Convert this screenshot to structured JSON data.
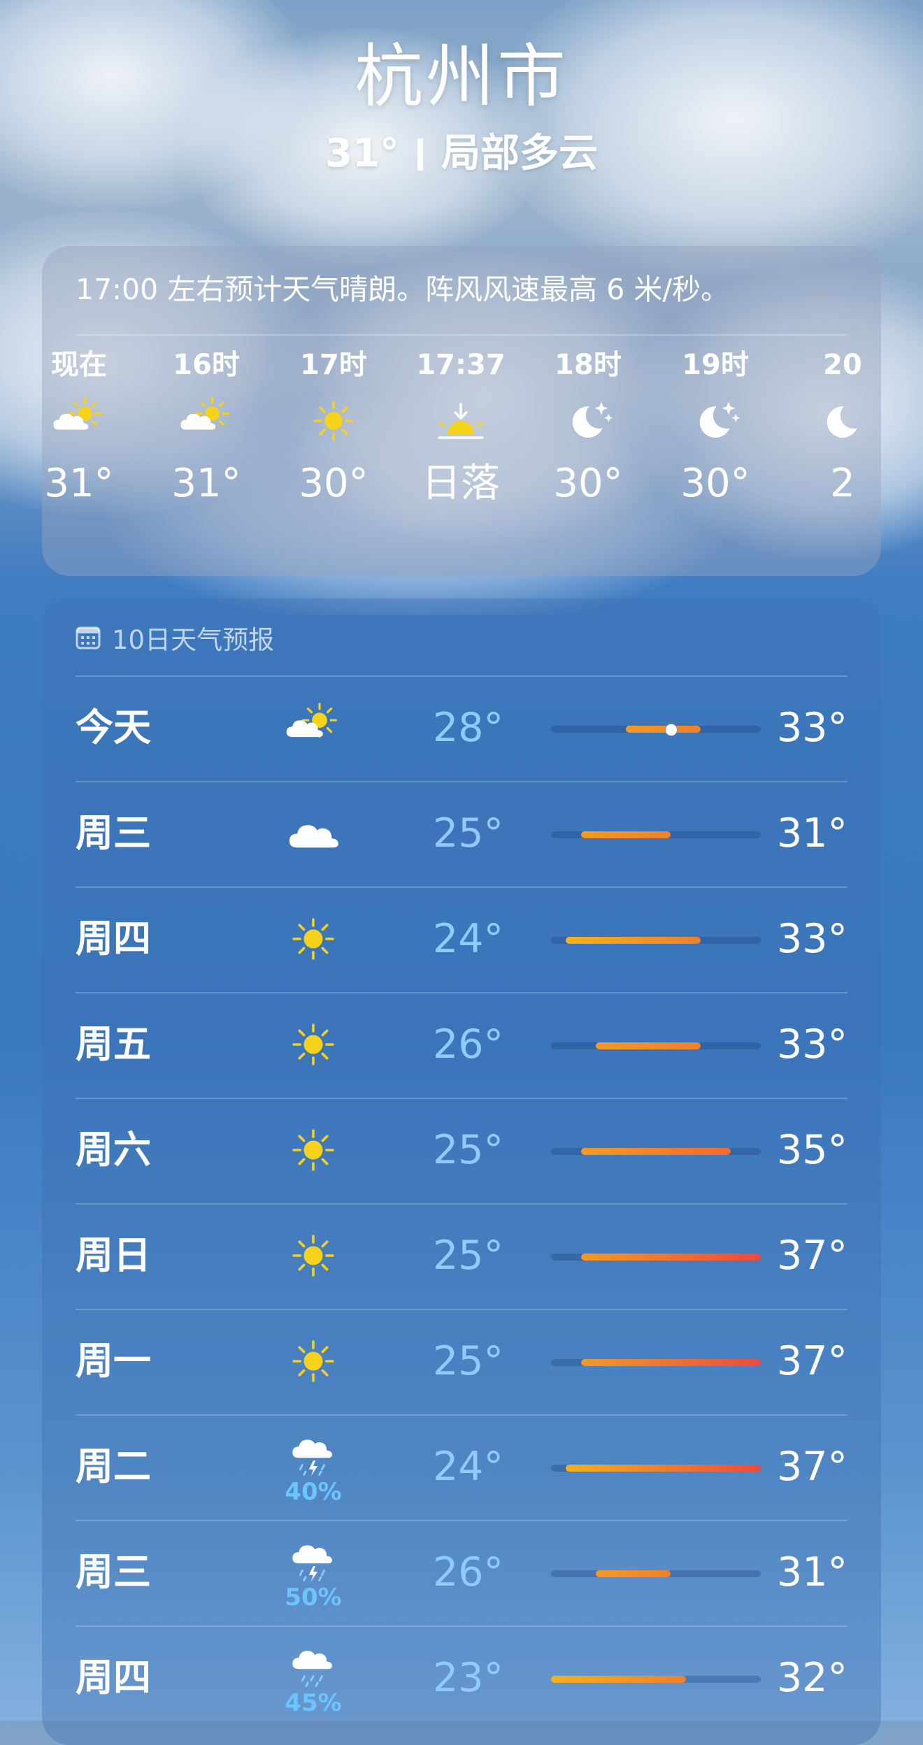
{
  "location": {
    "city": "杭州市",
    "current_temp": "31°",
    "condition": "局部多云"
  },
  "hourly": {
    "description": "17:00 左右预计天气晴朗。阵风风速最高 6 米/秒。",
    "items": [
      {
        "time": "现在",
        "icon": "partly-sunny-icon",
        "value": "31°"
      },
      {
        "time": "16时",
        "icon": "partly-sunny-icon",
        "value": "31°"
      },
      {
        "time": "17时",
        "icon": "sun-icon",
        "value": "30°"
      },
      {
        "time": "17:37",
        "icon": "sunset-icon",
        "value": "日落"
      },
      {
        "time": "18时",
        "icon": "moon-stars-icon",
        "value": "30°"
      },
      {
        "time": "19时",
        "icon": "moon-stars-icon",
        "value": "30°"
      },
      {
        "time": "20",
        "icon": "moon-icon",
        "value": "2"
      }
    ]
  },
  "daily": {
    "header": "10日天气预报",
    "range": {
      "min": 23,
      "max": 37
    },
    "days": [
      {
        "day": "今天",
        "icon": "partly-sunny-icon",
        "precip": "",
        "low": "28°",
        "high": "33°",
        "low_val": 28,
        "high_val": 33,
        "current": 31
      },
      {
        "day": "周三",
        "icon": "cloud-icon",
        "precip": "",
        "low": "25°",
        "high": "31°",
        "low_val": 25,
        "high_val": 31
      },
      {
        "day": "周四",
        "icon": "sun-icon",
        "precip": "",
        "low": "24°",
        "high": "33°",
        "low_val": 24,
        "high_val": 33
      },
      {
        "day": "周五",
        "icon": "sun-icon",
        "precip": "",
        "low": "26°",
        "high": "33°",
        "low_val": 26,
        "high_val": 33
      },
      {
        "day": "周六",
        "icon": "sun-icon",
        "precip": "",
        "low": "25°",
        "high": "35°",
        "low_val": 25,
        "high_val": 35
      },
      {
        "day": "周日",
        "icon": "sun-icon",
        "precip": "",
        "low": "25°",
        "high": "37°",
        "low_val": 25,
        "high_val": 37
      },
      {
        "day": "周一",
        "icon": "sun-icon",
        "precip": "",
        "low": "25°",
        "high": "37°",
        "low_val": 25,
        "high_val": 37
      },
      {
        "day": "周二",
        "icon": "thunderstorm-icon",
        "precip": "40%",
        "low": "24°",
        "high": "37°",
        "low_val": 24,
        "high_val": 37
      },
      {
        "day": "周三",
        "icon": "thunderstorm-icon",
        "precip": "50%",
        "low": "26°",
        "high": "31°",
        "low_val": 26,
        "high_val": 31
      },
      {
        "day": "周四",
        "icon": "rain-icon",
        "precip": "45%",
        "low": "23°",
        "high": "32°",
        "low_val": 23,
        "high_val": 32
      }
    ]
  },
  "colors": {
    "sun": "#f7d21b",
    "bar_cool": "#f5b11c",
    "bar_warm": "#f0802a",
    "bar_hot": "#ee4a3c",
    "low_temp": "#8ecbff",
    "precip": "#6cc4ff"
  }
}
